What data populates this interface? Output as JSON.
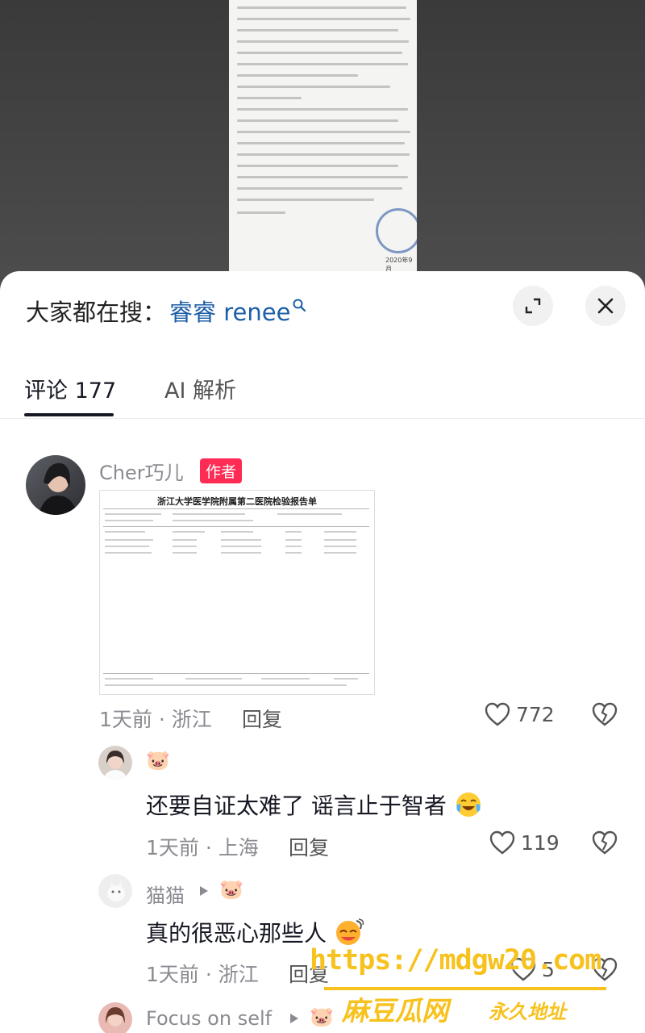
{
  "search": {
    "prefix": "大家都在搜：",
    "keyword": "睿睿 renee"
  },
  "tabs": [
    {
      "label": "评论 177",
      "active": true
    },
    {
      "label": "AI 解析",
      "active": false
    }
  ],
  "comments": [
    {
      "user": "Cher巧儿",
      "badge": "作者",
      "image_title": "浙江大学医学院附属第二医院检验报告单",
      "time_location": "1天前 · 浙江",
      "reply": "回复",
      "likes": "772"
    },
    {
      "user": "🐷",
      "text": "还要自证太难了 谣言止于智者",
      "time_location": "1天前 · 上海",
      "reply": "回复",
      "likes": "119"
    },
    {
      "user": "猫猫",
      "reply_to": "🐷",
      "text": "真的很恶心那些人",
      "time_location": "1天前 · 浙江",
      "reply": "回复",
      "likes": "5"
    },
    {
      "user": "Focus on self",
      "reply_to": "🐷"
    }
  ],
  "document": {
    "date": "2020年9月"
  },
  "watermark": {
    "url": "https://mdgw20.com",
    "name": "麻豆瓜网",
    "suffix": "永久地址"
  },
  "colors": {
    "accent": "#fe2c55",
    "link": "#1d5ea8",
    "watermark": "#f7c21e"
  }
}
